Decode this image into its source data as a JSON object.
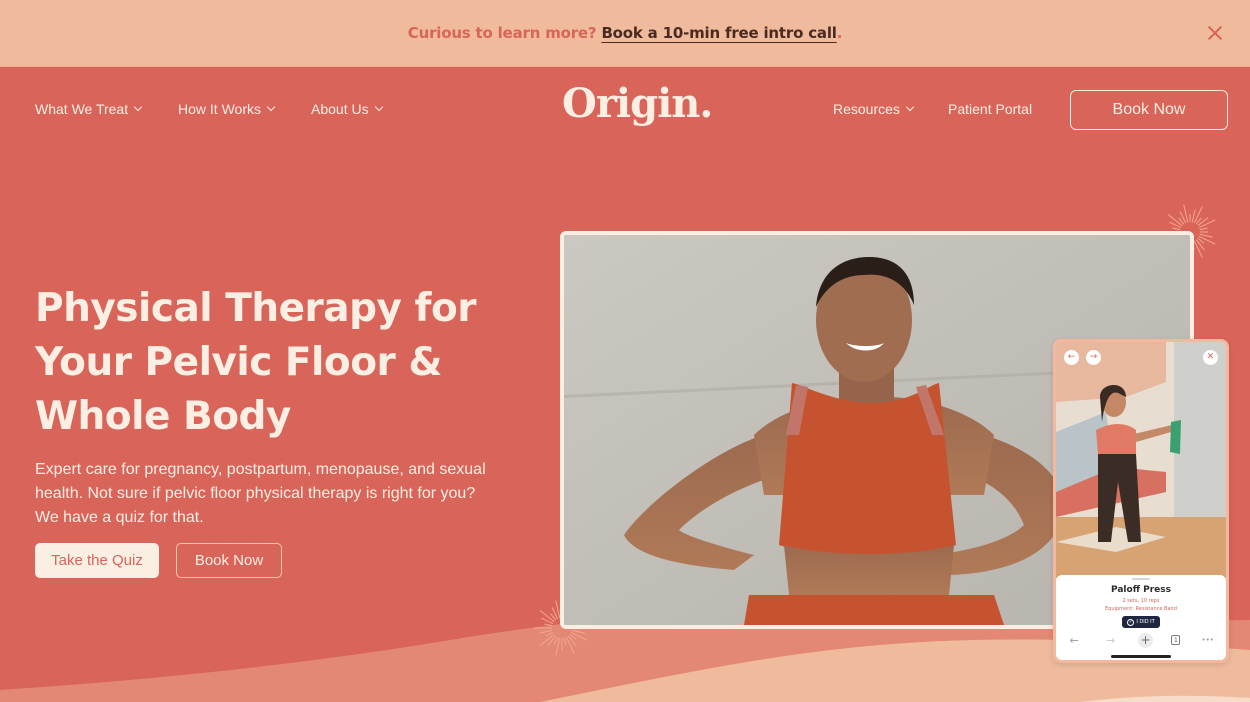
{
  "announcement": {
    "question": "Curious to learn more?",
    "link_text": "Book a 10-min free intro call",
    "trailing": ".",
    "close_icon": "close-icon"
  },
  "nav": {
    "left_items": [
      {
        "label": "What We Treat",
        "has_dropdown": true
      },
      {
        "label": "How It Works",
        "has_dropdown": true
      },
      {
        "label": "About Us",
        "has_dropdown": true
      }
    ],
    "logo": "Origin.",
    "right_items": [
      {
        "label": "Resources",
        "has_dropdown": true
      },
      {
        "label": "Patient Portal",
        "has_dropdown": false
      }
    ],
    "cta": "Book Now"
  },
  "hero": {
    "title_lines": [
      "Physical Therapy for",
      "Your Pelvic Floor &",
      "Whole Body"
    ],
    "subtitle": "Expert care for pregnancy, postpartum, menopause, and sexual health. Not sure if pelvic floor physical therapy is right for you? We have a quiz for that.",
    "primary_button": "Take the Quiz",
    "secondary_button": "Book Now"
  },
  "phone_mockup": {
    "prev_icon": "←",
    "next_icon": "→",
    "close_icon": "✕",
    "exercise_title": "Paloff Press",
    "exercise_sets": "2 sets, 10 reps",
    "exercise_equipment": "Equipment: Resistance Band",
    "done_button": "I DID IT",
    "bottom_bar": {
      "back": "←",
      "forward": "→",
      "add": "+",
      "tabs_count": "1",
      "more": "•••"
    }
  },
  "colors": {
    "brand_coral": "#d9645a",
    "announcement_bg": "#efbb9c",
    "cream": "#fbeee2",
    "dark_brown": "#4b2a22",
    "navy": "#1f2740"
  }
}
